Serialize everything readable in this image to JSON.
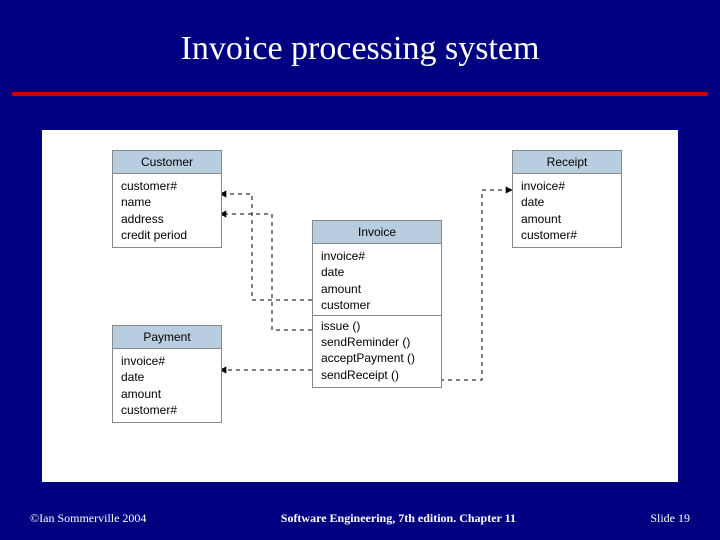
{
  "title": "Invoice processing system",
  "classes": {
    "customer": {
      "name": "Customer",
      "attrs": [
        "customer#",
        "name",
        "address",
        "credit period"
      ]
    },
    "receipt": {
      "name": "Receipt",
      "attrs": [
        "invoice#",
        "date",
        "amount",
        "customer#"
      ]
    },
    "invoice": {
      "name": "Invoice",
      "attrs": [
        "invoice#",
        "date",
        "amount",
        "customer"
      ],
      "ops": [
        "issue ()",
        "sendReminder ()",
        "acceptPayment ()",
        "sendReceipt ()"
      ]
    },
    "payment": {
      "name": "Payment",
      "attrs": [
        "invoice#",
        "date",
        "amount",
        "customer#"
      ]
    }
  },
  "footer": {
    "left": "©Ian Sommerville 2004",
    "center": "Software Engineering, 7th edition. Chapter 11",
    "right": "Slide 19"
  }
}
